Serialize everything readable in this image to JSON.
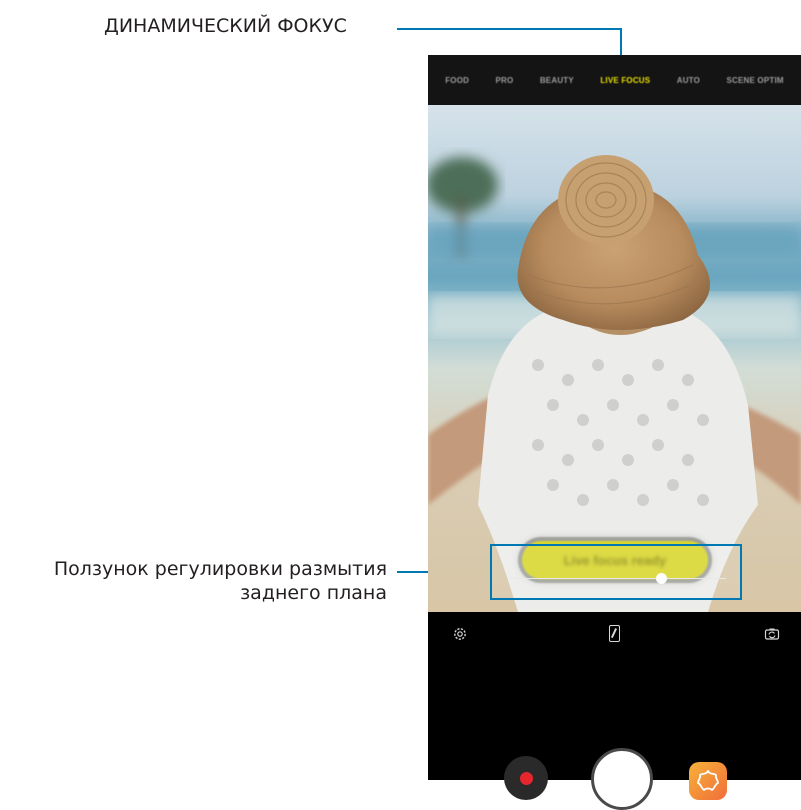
{
  "callouts": {
    "live_focus_label": "ДИНАМИЧЕСКИЙ ФОКУС",
    "slider_label_line1": "Ползунок регулировки размытия",
    "slider_label_line2": "заднего плана"
  },
  "camera": {
    "modes": [
      "FOOD",
      "PRO",
      "BEAUTY",
      "LIVE FOCUS",
      "AUTO",
      "SCENE OPTIM"
    ],
    "active_mode": "LIVE FOCUS",
    "status_pill": "Live focus ready",
    "blur_level_fraction": 0.7
  },
  "icons": {
    "settings": "gear-icon",
    "ratio": "aspect-ratio-icon",
    "switch_camera": "switch-camera-icon",
    "record": "record-icon",
    "shutter": "shutter-button",
    "bixby": "bixby-vision-icon"
  },
  "colors": {
    "callout_line": "#0078b4",
    "active_mode": "#e8e000",
    "pill": "#d9d62c",
    "record_dot": "#e5262c"
  }
}
